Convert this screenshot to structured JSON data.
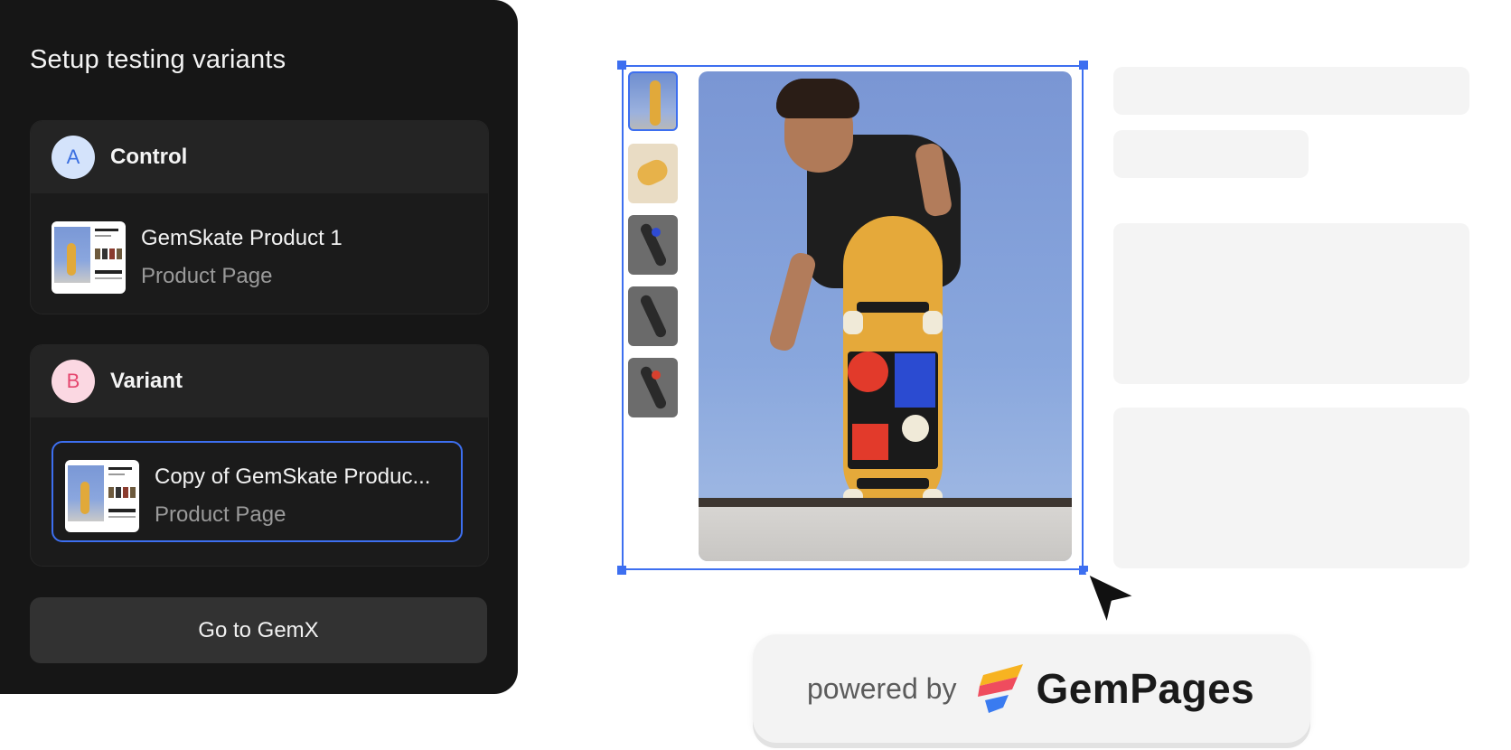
{
  "panel": {
    "title": "Setup testing variants",
    "control": {
      "badge": "A",
      "label": "Control",
      "page_name": "GemSkate Product 1",
      "page_type": "Product Page"
    },
    "variant": {
      "badge": "B",
      "label": "Variant",
      "page_name": "Copy of GemSkate Produc...",
      "page_type": "Product Page"
    },
    "button": "Go to GemX"
  },
  "powered": {
    "text": "powered by",
    "brand": "GemPages"
  },
  "colors": {
    "accent": "#3d6ff0",
    "panel_bg": "#161616",
    "badge_a": "#d4e3fb",
    "badge_b": "#fbd8e2"
  }
}
